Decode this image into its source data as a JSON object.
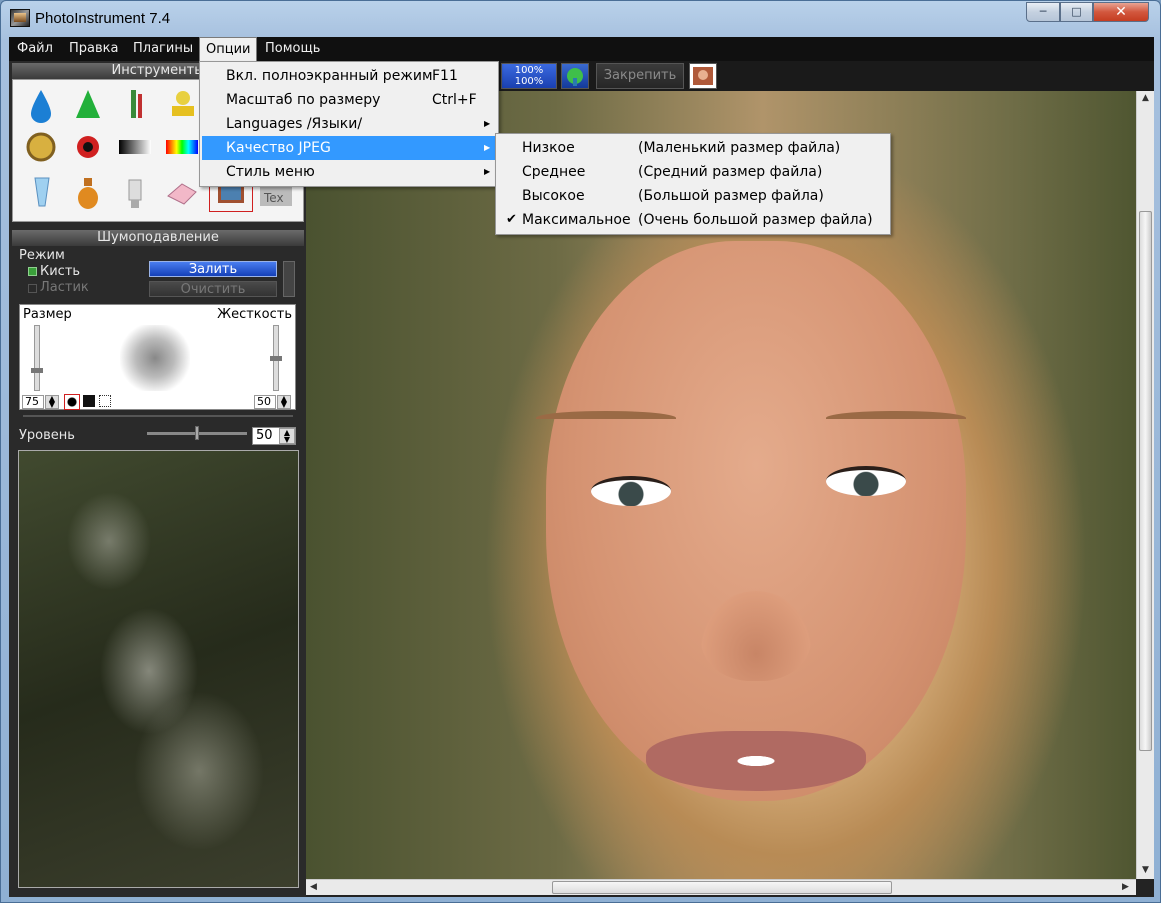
{
  "window": {
    "title": "PhotoInstrument 7.4"
  },
  "menubar": {
    "items": [
      "Файл",
      "Правка",
      "Плагины",
      "Опции",
      "Помощь"
    ],
    "active": "Опции"
  },
  "toolbar": {
    "lock_label": "Закрепить",
    "zoom_label_top": "100%",
    "zoom_label_bottom": "100%"
  },
  "tools_panel": {
    "title": "Инструменты"
  },
  "noise_panel": {
    "title": "Шумоподавление",
    "mode_label": "Режим",
    "brush_label": "Кисть",
    "eraser_label": "Ластик",
    "fill_button": "Залить",
    "clear_button": "Очистить",
    "size_label": "Размер",
    "hardness_label": "Жесткость",
    "size_value": "75",
    "hardness_value": "50",
    "level_label": "Уровень",
    "level_value": "50"
  },
  "options_menu": {
    "items": [
      {
        "label": "Вкл. полноэкранный режим",
        "shortcut": "F11"
      },
      {
        "label": "Масштаб по размеру",
        "shortcut": "Ctrl+F"
      },
      {
        "label": "Languages /Языки/",
        "shortcut": ""
      },
      {
        "label": "Качество JPEG",
        "shortcut": ""
      },
      {
        "label": "Стиль меню",
        "shortcut": ""
      }
    ],
    "highlighted": "Качество JPEG"
  },
  "jpeg_quality_menu": {
    "items": [
      {
        "name": "Низкое",
        "desc": "(Маленький размер файла)",
        "checked": false
      },
      {
        "name": "Среднее",
        "desc": "(Средний размер файла)",
        "checked": false
      },
      {
        "name": "Высокое",
        "desc": "(Большой размер файла)",
        "checked": false
      },
      {
        "name": "Максимальное",
        "desc": "(Очень большой размер файла)",
        "checked": true
      }
    ]
  },
  "colors": {
    "highlight": "#3399ff",
    "menubar": "#101010",
    "panel": "#2a2a2a"
  }
}
